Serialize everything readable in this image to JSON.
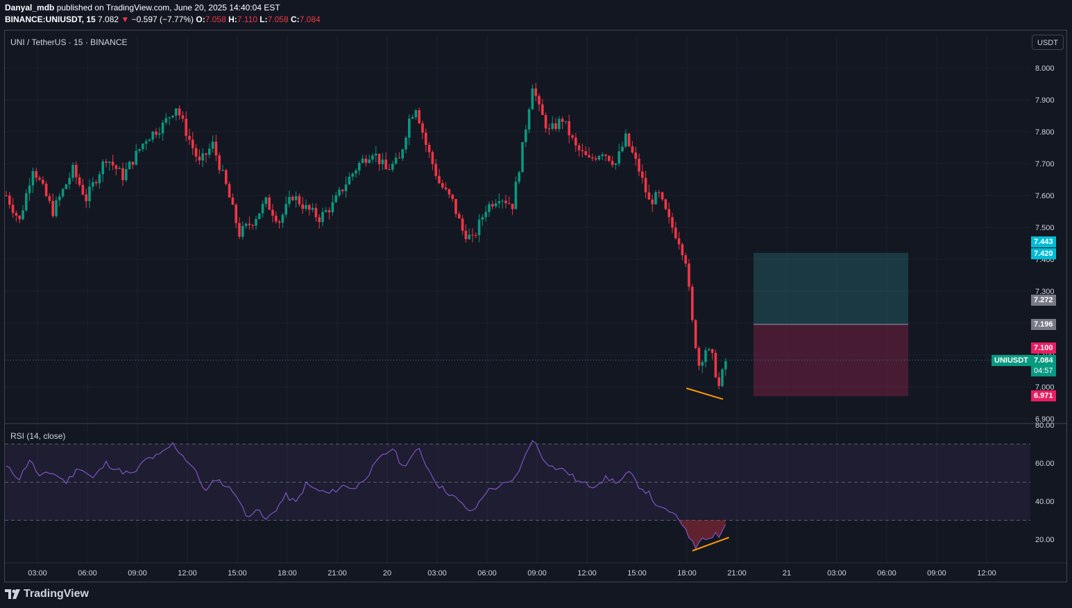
{
  "header": {
    "author": "Danyal_mdb",
    "published_text": " published on TradingView.com, June 20, 2025 14:40:04 EST",
    "symbol_line": "BINANCE:UNIUSDT, 15",
    "last": "7.082",
    "change": "−0.597 (−7.77%)",
    "o_label": "O:",
    "o": "7.058",
    "h_label": "H:",
    "h": "7.110",
    "l_label": "L:",
    "l": "7.058",
    "c_label": "C:",
    "c": "7.084"
  },
  "legend": {
    "main": "UNI / TetherUS · 15 · BINANCE",
    "rsi": "RSI (14, close)"
  },
  "currency_button": "USDT",
  "price_tags": {
    "tp_top": "7.443",
    "tp": "7.420",
    "mid_gray": "7.272",
    "entry": "7.196",
    "high_tag": "7.100",
    "symbol": "UNIUSDT",
    "last": "7.084",
    "countdown": "04:57",
    "stop": "6.971"
  },
  "footer": {
    "brand": "TradingView"
  },
  "colors": {
    "background": "#131722",
    "up": "#089981",
    "down": "#f23645",
    "rsi": "#7e57c2",
    "target_zone": "#22505a",
    "stop_zone": "#5a1f3a",
    "annotation": "#ff9800",
    "tp_tag": "#00bcd4",
    "stop_tag": "#e91e63"
  },
  "chart_data": [
    {
      "type": "candlestick",
      "title": "UNI / TetherUS · 15 · BINANCE",
      "y_ticks": [
        "8.000",
        "7.900",
        "7.800",
        "7.700",
        "7.600",
        "7.500",
        "7.400",
        "7.300",
        "7.200",
        "7.100",
        "7.000",
        "6.900"
      ],
      "ylim": [
        6.9,
        8.05
      ],
      "x_ticks": [
        "03:00",
        "06:00",
        "09:00",
        "12:00",
        "15:00",
        "18:00",
        "21:00",
        "20",
        "03:00",
        "06:00",
        "09:00",
        "12:00",
        "15:00",
        "18:00",
        "21:00",
        "21",
        "03:00",
        "06:00",
        "09:00",
        "12:00"
      ],
      "close_path": [
        {
          "t": 0,
          "v": 7.6
        },
        {
          "t": 4,
          "v": 7.52
        },
        {
          "t": 8,
          "v": 7.69
        },
        {
          "t": 14,
          "v": 7.55
        },
        {
          "t": 20,
          "v": 7.68
        },
        {
          "t": 24,
          "v": 7.59
        },
        {
          "t": 30,
          "v": 7.72
        },
        {
          "t": 35,
          "v": 7.66
        },
        {
          "t": 42,
          "v": 7.78
        },
        {
          "t": 47,
          "v": 7.82
        },
        {
          "t": 51,
          "v": 7.88
        },
        {
          "t": 54,
          "v": 7.8
        },
        {
          "t": 58,
          "v": 7.7
        },
        {
          "t": 62,
          "v": 7.76
        },
        {
          "t": 66,
          "v": 7.63
        },
        {
          "t": 70,
          "v": 7.48
        },
        {
          "t": 74,
          "v": 7.52
        },
        {
          "t": 78,
          "v": 7.58
        },
        {
          "t": 82,
          "v": 7.52
        },
        {
          "t": 86,
          "v": 7.6
        },
        {
          "t": 90,
          "v": 7.56
        },
        {
          "t": 94,
          "v": 7.53
        },
        {
          "t": 98,
          "v": 7.57
        },
        {
          "t": 102,
          "v": 7.64
        },
        {
          "t": 106,
          "v": 7.7
        },
        {
          "t": 110,
          "v": 7.74
        },
        {
          "t": 114,
          "v": 7.68
        },
        {
          "t": 118,
          "v": 7.71
        },
        {
          "t": 121,
          "v": 7.84
        },
        {
          "t": 123,
          "v": 7.88
        },
        {
          "t": 126,
          "v": 7.76
        },
        {
          "t": 130,
          "v": 7.64
        },
        {
          "t": 134,
          "v": 7.58
        },
        {
          "t": 137,
          "v": 7.49
        },
        {
          "t": 140,
          "v": 7.46
        },
        {
          "t": 144,
          "v": 7.56
        },
        {
          "t": 148,
          "v": 7.6
        },
        {
          "t": 152,
          "v": 7.57
        },
        {
          "t": 155,
          "v": 7.75
        },
        {
          "t": 158,
          "v": 7.95
        },
        {
          "t": 160,
          "v": 7.87
        },
        {
          "t": 163,
          "v": 7.8
        },
        {
          "t": 167,
          "v": 7.84
        },
        {
          "t": 171,
          "v": 7.75
        },
        {
          "t": 175,
          "v": 7.71
        },
        {
          "t": 179,
          "v": 7.74
        },
        {
          "t": 183,
          "v": 7.7
        },
        {
          "t": 186,
          "v": 7.78
        },
        {
          "t": 190,
          "v": 7.68
        },
        {
          "t": 193,
          "v": 7.58
        },
        {
          "t": 196,
          "v": 7.6
        },
        {
          "t": 199,
          "v": 7.52
        },
        {
          "t": 202,
          "v": 7.46
        },
        {
          "t": 204,
          "v": 7.4
        },
        {
          "t": 206,
          "v": 7.2
        },
        {
          "t": 208,
          "v": 7.07
        },
        {
          "t": 210,
          "v": 7.12
        },
        {
          "t": 212,
          "v": 7.09
        },
        {
          "t": 214,
          "v": 7.0
        },
        {
          "t": 216,
          "v": 7.08
        }
      ],
      "last_price": 7.084,
      "target": 7.42,
      "entry": 7.196,
      "stop": 6.971,
      "price_low_annotation": [
        {
          "t": 204,
          "v": 7.0
        },
        {
          "t": 215,
          "v": 6.97
        }
      ]
    },
    {
      "type": "line",
      "title": "RSI (14, close)",
      "y_ticks": [
        "80.00",
        "60.00",
        "40.00",
        "20.00"
      ],
      "ylim": [
        13,
        80
      ],
      "bands": [
        70,
        50,
        30
      ],
      "rsi_path": [
        {
          "t": 0,
          "v": 58
        },
        {
          "t": 4,
          "v": 52
        },
        {
          "t": 7,
          "v": 62
        },
        {
          "t": 10,
          "v": 53
        },
        {
          "t": 14,
          "v": 55
        },
        {
          "t": 18,
          "v": 50
        },
        {
          "t": 22,
          "v": 58
        },
        {
          "t": 26,
          "v": 52
        },
        {
          "t": 30,
          "v": 60
        },
        {
          "t": 34,
          "v": 56
        },
        {
          "t": 38,
          "v": 54
        },
        {
          "t": 42,
          "v": 62
        },
        {
          "t": 46,
          "v": 64
        },
        {
          "t": 50,
          "v": 70
        },
        {
          "t": 53,
          "v": 64
        },
        {
          "t": 56,
          "v": 58
        },
        {
          "t": 60,
          "v": 45
        },
        {
          "t": 63,
          "v": 52
        },
        {
          "t": 66,
          "v": 48
        },
        {
          "t": 69,
          "v": 44
        },
        {
          "t": 72,
          "v": 32
        },
        {
          "t": 75,
          "v": 36
        },
        {
          "t": 78,
          "v": 30
        },
        {
          "t": 81,
          "v": 36
        },
        {
          "t": 84,
          "v": 43
        },
        {
          "t": 87,
          "v": 39
        },
        {
          "t": 90,
          "v": 49
        },
        {
          "t": 93,
          "v": 46
        },
        {
          "t": 97,
          "v": 44
        },
        {
          "t": 101,
          "v": 48
        },
        {
          "t": 105,
          "v": 47
        },
        {
          "t": 109,
          "v": 55
        },
        {
          "t": 112,
          "v": 62
        },
        {
          "t": 116,
          "v": 68
        },
        {
          "t": 119,
          "v": 58
        },
        {
          "t": 122,
          "v": 64
        },
        {
          "t": 124,
          "v": 67
        },
        {
          "t": 127,
          "v": 56
        },
        {
          "t": 130,
          "v": 48
        },
        {
          "t": 134,
          "v": 43
        },
        {
          "t": 137,
          "v": 38
        },
        {
          "t": 140,
          "v": 34
        },
        {
          "t": 144,
          "v": 45
        },
        {
          "t": 148,
          "v": 48
        },
        {
          "t": 152,
          "v": 50
        },
        {
          "t": 155,
          "v": 60
        },
        {
          "t": 158,
          "v": 73
        },
        {
          "t": 161,
          "v": 63
        },
        {
          "t": 164,
          "v": 58
        },
        {
          "t": 168,
          "v": 56
        },
        {
          "t": 172,
          "v": 50
        },
        {
          "t": 176,
          "v": 48
        },
        {
          "t": 180,
          "v": 52
        },
        {
          "t": 184,
          "v": 50
        },
        {
          "t": 187,
          "v": 55
        },
        {
          "t": 190,
          "v": 48
        },
        {
          "t": 193,
          "v": 44
        },
        {
          "t": 196,
          "v": 36
        },
        {
          "t": 199,
          "v": 35
        },
        {
          "t": 202,
          "v": 30
        },
        {
          "t": 204,
          "v": 26
        },
        {
          "t": 206,
          "v": 18
        },
        {
          "t": 207,
          "v": 16
        },
        {
          "t": 209,
          "v": 22
        },
        {
          "t": 211,
          "v": 20
        },
        {
          "t": 213,
          "v": 24
        },
        {
          "t": 214,
          "v": 21
        },
        {
          "t": 216,
          "v": 28
        }
      ],
      "divergence_annotation": [
        {
          "t": 206,
          "v": 14
        },
        {
          "t": 217,
          "v": 21
        }
      ]
    }
  ]
}
